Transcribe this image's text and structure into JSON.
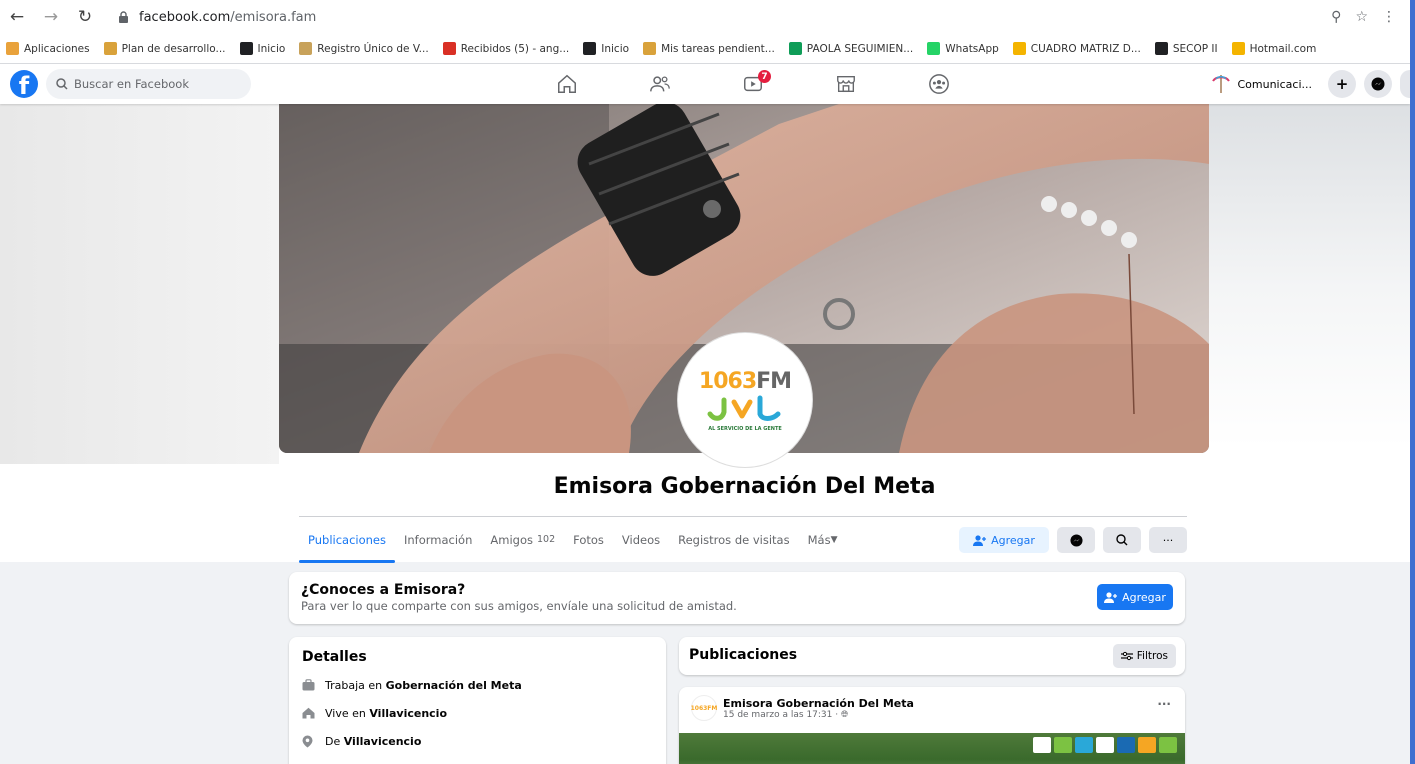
{
  "browser": {
    "url_host": "facebook.com",
    "url_path": "/emisora.fam",
    "bookmarks": [
      {
        "label": "Aplicaciones",
        "color": "#e9a23b"
      },
      {
        "label": "Plan de desarrollo...",
        "color": "#d9a23b"
      },
      {
        "label": "Inicio",
        "color": "#202124"
      },
      {
        "label": "Registro Único de V...",
        "color": "#c8a25a"
      },
      {
        "label": "Recibidos (5) - ang...",
        "color": "#d93025"
      },
      {
        "label": "Inicio",
        "color": "#202124"
      },
      {
        "label": "Mis tareas pendient...",
        "color": "#d9a23b"
      },
      {
        "label": "PAOLA SEGUIMIEN...",
        "color": "#0f9d58"
      },
      {
        "label": "WhatsApp",
        "color": "#25d366"
      },
      {
        "label": "CUADRO MATRIZ D...",
        "color": "#f4b400"
      },
      {
        "label": "SECOP II",
        "color": "#202124"
      },
      {
        "label": "Hotmail.com",
        "color": "#f4b400"
      }
    ]
  },
  "fb": {
    "search_placeholder": "Buscar en Facebook",
    "watch_badge": "7",
    "profile_name": "Comunicaci...",
    "accent": "#1877f2"
  },
  "profile": {
    "logo_number": "1063",
    "logo_fm": "FM",
    "logo_tagline": "AL SERVICIO DE LA GENTE",
    "name": "Emisora Gobernación Del Meta"
  },
  "tabs": [
    {
      "label": "Publicaciones",
      "count": ""
    },
    {
      "label": "Información",
      "count": ""
    },
    {
      "label": "Amigos",
      "count": "102"
    },
    {
      "label": "Fotos",
      "count": ""
    },
    {
      "label": "Videos",
      "count": ""
    },
    {
      "label": "Registros de visitas",
      "count": ""
    },
    {
      "label": "Más",
      "count": ""
    }
  ],
  "actions": {
    "add_friend": "Agregar"
  },
  "conoces": {
    "title": "¿Conoces a Emisora?",
    "text": "Para ver lo que comparte con sus amigos, envíale una solicitud de amistad.",
    "button": "Agregar"
  },
  "detalles": {
    "title": "Detalles",
    "items": [
      {
        "pre": "Trabaja en ",
        "bold": "Gobernación del Meta",
        "icon": "briefcase-icon"
      },
      {
        "pre": "Vive en ",
        "bold": "Villavicencio",
        "icon": "home-icon"
      },
      {
        "pre": "De ",
        "bold": "Villavicencio",
        "icon": "location-pin-icon"
      }
    ]
  },
  "publicaciones": {
    "title": "Publicaciones",
    "filter": "Filtros",
    "post": {
      "author": "Emisora Gobernación Del Meta",
      "date": "15 de marzo a las 17:31 · "
    }
  }
}
